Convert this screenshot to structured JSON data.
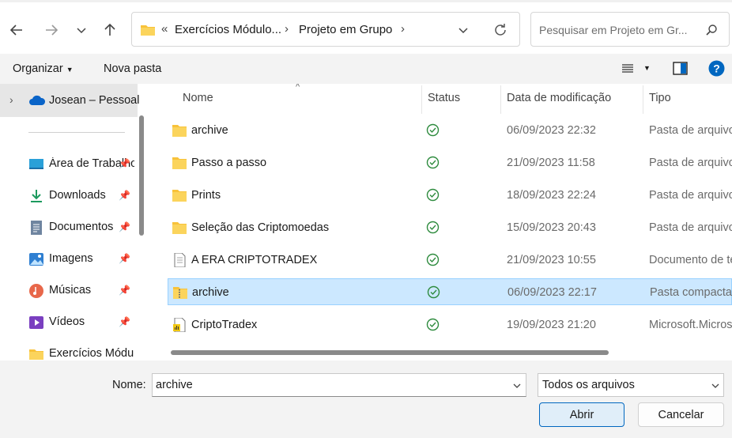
{
  "nav": {
    "back_icon": "arrow-left-icon",
    "forward_icon": "arrow-right-icon",
    "recent_icon": "chevron-down-icon",
    "up_icon": "arrow-up-icon"
  },
  "address": {
    "overflow": "«",
    "crumbs": [
      "Exercícios Módulo...",
      "Projeto em Grupo"
    ],
    "refresh_icon": "refresh-icon"
  },
  "search": {
    "placeholder": "Pesquisar em Projeto em Gr..."
  },
  "commands": {
    "organize": "Organizar",
    "new_folder": "Nova pasta"
  },
  "sidebar": {
    "onedrive": "Josean – Pessoal",
    "items": [
      {
        "label": "Área de Trabalho",
        "icon": "desktop-icon"
      },
      {
        "label": "Downloads",
        "icon": "download-icon"
      },
      {
        "label": "Documentos",
        "icon": "document-icon"
      },
      {
        "label": "Imagens",
        "icon": "pictures-icon"
      },
      {
        "label": "Músicas",
        "icon": "music-icon"
      },
      {
        "label": "Vídeos",
        "icon": "video-icon"
      },
      {
        "label": "Exercícios Módulo",
        "icon": "folder-icon"
      }
    ]
  },
  "columns": {
    "name": "Nome",
    "status": "Status",
    "modified": "Data de modificação",
    "type": "Tipo"
  },
  "files": [
    {
      "name": "archive",
      "date": "06/09/2023 22:32",
      "type": "Pasta de arquivos",
      "icon": "folder-icon"
    },
    {
      "name": "Passo a passo",
      "date": "21/09/2023 11:58",
      "type": "Pasta de arquivos",
      "icon": "folder-icon"
    },
    {
      "name": "Prints",
      "date": "18/09/2023 22:24",
      "type": "Pasta de arquivos",
      "icon": "folder-icon"
    },
    {
      "name": "Seleção das Criptomoedas",
      "date": "15/09/2023 20:43",
      "type": "Pasta de arquivos",
      "icon": "folder-icon"
    },
    {
      "name": "A ERA CRIPTOTRADEX",
      "date": "21/09/2023 10:55",
      "type": "Documento de texto",
      "icon": "text-file-icon"
    },
    {
      "name": "archive",
      "date": "06/09/2023 22:17",
      "type": "Pasta compactada",
      "icon": "zip-folder-icon"
    },
    {
      "name": "CriptoTradex",
      "date": "19/09/2023 21:20",
      "type": "Microsoft.Microsoft",
      "icon": "powerbi-file-icon"
    }
  ],
  "bottom": {
    "name_label": "Nome:",
    "filename": "archive",
    "filter": "Todos os arquivos",
    "open": "Abrir",
    "cancel": "Cancelar"
  },
  "colors": {
    "accent": "#0067c0",
    "selection": "#cce8ff",
    "folder": "#f8c23a",
    "synced": "#2e8b3e"
  }
}
